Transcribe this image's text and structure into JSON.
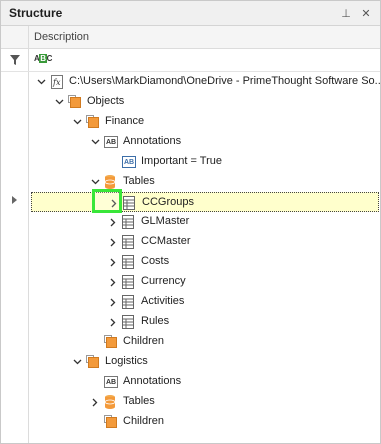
{
  "panel": {
    "title": "Structure",
    "pin_glyph": "⊥",
    "close_glyph": "✕",
    "column_header": "Description",
    "filter_icon": "filter-icon",
    "abc_icon": {
      "left": "A",
      "mid": "B",
      "right": "C"
    }
  },
  "tree": [
    {
      "label": "C:\\Users\\MarkDiamond\\OneDrive - PrimeThought Software So...",
      "icon": "function-icon",
      "expanded": true
    },
    {
      "label": "Objects",
      "icon": "object-icon",
      "expanded": true
    },
    {
      "label": "Finance",
      "icon": "object-icon",
      "expanded": true
    },
    {
      "label": "Annotations",
      "icon": "annotation-icon",
      "expanded": true
    },
    {
      "label": "Important = True",
      "icon": "annotation-value-icon",
      "badge": "AB"
    },
    {
      "label": "Tables",
      "icon": "database-icon",
      "expanded": true
    },
    {
      "label": "CCGroups",
      "icon": "table-icon",
      "expanded": false,
      "selected": true
    },
    {
      "label": "GLMaster",
      "icon": "table-icon",
      "expanded": false
    },
    {
      "label": "CCMaster",
      "icon": "table-icon",
      "expanded": false
    },
    {
      "label": "Costs",
      "icon": "table-icon",
      "expanded": false
    },
    {
      "label": "Currency",
      "icon": "table-icon",
      "expanded": false
    },
    {
      "label": "Activities",
      "icon": "table-icon",
      "expanded": false
    },
    {
      "label": "Rules",
      "icon": "table-icon",
      "expanded": false
    },
    {
      "label": "Children",
      "icon": "object-icon"
    },
    {
      "label": "Logistics",
      "icon": "object-icon",
      "expanded": true
    },
    {
      "label": "Annotations",
      "icon": "annotation-icon",
      "badge": "AB"
    },
    {
      "label": "Tables",
      "icon": "database-icon",
      "expanded": false
    },
    {
      "label": "Children",
      "icon": "object-icon"
    }
  ],
  "colors": {
    "selected_row": "#ffffcc",
    "highlight_box": "#39e639",
    "object_orange": "#f39a3b"
  }
}
